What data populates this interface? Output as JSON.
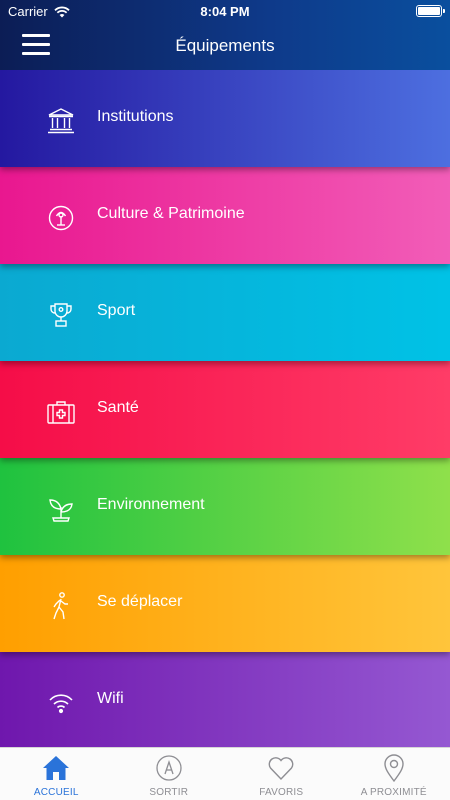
{
  "status_bar": {
    "carrier": "Carrier",
    "time": "8:04 PM"
  },
  "header": {
    "title": "Équipements",
    "menu_icon": "hamburger-icon"
  },
  "categories": [
    {
      "label": "Institutions",
      "icon": "institution-building-icon",
      "gradient": [
        "#2418a0",
        "#4d6fe0"
      ]
    },
    {
      "label": "Culture & Patrimoine",
      "icon": "culture-icon",
      "gradient": [
        "#e9178f",
        "#f25db8"
      ]
    },
    {
      "label": "Sport",
      "icon": "trophy-icon",
      "gradient": [
        "#0ba9d1",
        "#00c2e6"
      ]
    },
    {
      "label": "Santé",
      "icon": "first-aid-kit-icon",
      "gradient": [
        "#f50d48",
        "#ff3c67"
      ]
    },
    {
      "label": "Environnement",
      "icon": "plant-sprout-icon",
      "gradient": [
        "#1fc23f",
        "#8fe04b"
      ]
    },
    {
      "label": "Se déplacer",
      "icon": "walking-person-icon",
      "gradient": [
        "#ff9f00",
        "#ffc53b"
      ]
    },
    {
      "label": "Wifi",
      "icon": "wifi-icon",
      "gradient": [
        "#6f17ad",
        "#9558d2"
      ]
    }
  ],
  "tabs": [
    {
      "label": "ACCUEIL",
      "icon": "home-icon",
      "active": true
    },
    {
      "label": "SORTIR",
      "icon": "compass-a-icon",
      "active": false
    },
    {
      "label": "FAVORIS",
      "icon": "heart-icon",
      "active": false
    },
    {
      "label": "A PROXIMITÉ",
      "icon": "location-pin-icon",
      "active": false
    }
  ],
  "colors": {
    "tab_active": "#2a73d9",
    "tab_inactive": "#8e8e93"
  }
}
